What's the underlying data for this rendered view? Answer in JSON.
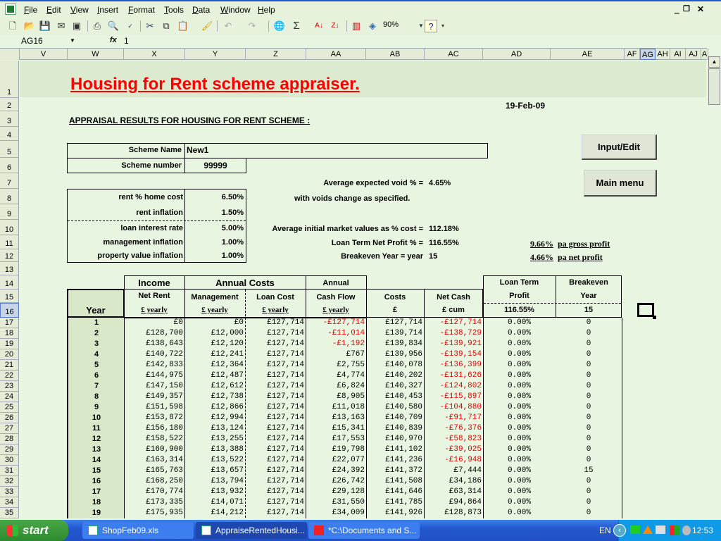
{
  "menubar": {
    "items": [
      "File",
      "Edit",
      "View",
      "Insert",
      "Format",
      "Tools",
      "Data",
      "Window",
      "Help"
    ],
    "window_controls": [
      "minimize",
      "restore",
      "close"
    ]
  },
  "toolbar": {
    "icons": [
      "new-icon",
      "open-icon",
      "save-icon",
      "email-icon",
      "permission-icon",
      "print-icon",
      "print-preview-icon",
      "spelling-icon",
      "cut-icon",
      "copy-icon",
      "paste-icon",
      "format-painter-icon",
      "undo-icon",
      "redo-icon",
      "hyperlink-icon",
      "autosum-icon",
      "sort-asc-icon",
      "sort-desc-icon",
      "chart-wizard-icon",
      "drawing-icon",
      "help-icon"
    ],
    "zoom": "90%"
  },
  "formula_bar": {
    "name_box": "AG16",
    "fx_label": "fx",
    "value": "1"
  },
  "columns": [
    "V",
    "W",
    "X",
    "Y",
    "Z",
    "AA",
    "AB",
    "AC",
    "AD",
    "AE",
    "AF",
    "AG",
    "AH",
    "AI",
    "AJ",
    "A"
  ],
  "selected_column": "AG",
  "rows": [
    "1",
    "2",
    "3",
    "4",
    "5",
    "6",
    "7",
    "8",
    "9",
    "10",
    "11",
    "12",
    "13",
    "14",
    "15",
    "16",
    "17",
    "18",
    "19",
    "20",
    "21",
    "22",
    "23",
    "24",
    "25",
    "26",
    "27",
    "28",
    "29",
    "30",
    "31",
    "32",
    "33",
    "34",
    "35"
  ],
  "selected_row": "16",
  "sheet": {
    "title": "Housing for Rent scheme appraiser.",
    "subtitle": "APPRAISAL RESULTS FOR HOUSING FOR RENT SCHEME :",
    "date": "19-Feb-09",
    "scheme_name_label": "Scheme Name",
    "scheme_name": "New1",
    "scheme_number_label": "Scheme number",
    "scheme_number": "99999",
    "params": [
      {
        "label": "rent % home cost",
        "value": "6.50%"
      },
      {
        "label": "rent inflation",
        "value": "1.50%"
      },
      {
        "label": "loan interest rate",
        "value": "5.00%"
      },
      {
        "label": "management inflation",
        "value": "1.00%"
      },
      {
        "label": "property value inflation",
        "value": "1.00%"
      }
    ],
    "void_label": "Average expected void % =",
    "void_value": "4.65%",
    "void_note": "with voids change as specified.",
    "market_label": "Average initial market values as % cost =",
    "market_value": "112.18%",
    "profit_label": "Loan Term Net Profit % =",
    "profit_value": "116.55%",
    "breakeven_label": "Breakeven Year = year",
    "breakeven_value": "15",
    "gross_pct": "9.66%",
    "gross_label": "pa gross profit",
    "net_pct": "4.66%",
    "net_label": "pa net profit",
    "buttons": {
      "input_edit": "Input/Edit",
      "main_menu": "Main menu"
    }
  },
  "table": {
    "group_headers": {
      "income": "Income",
      "annual_costs": "Annual Costs",
      "annual": "Annual",
      "loan_term": "Loan Term",
      "breakeven": "Breakeven"
    },
    "headers": {
      "year": "Year",
      "net_rent": "Net Rent",
      "net_rent_unit": "£ yearly",
      "management": "Management",
      "management_unit": "£ yearly",
      "loan_cost": "Loan Cost",
      "loan_cost_unit": "£ yearly",
      "cash_flow": "Cash Flow",
      "cash_flow_unit": "£ yearly",
      "costs": "Costs",
      "costs_unit": "£",
      "net_cash": "Net Cash",
      "net_cash_unit": "£ cum",
      "profit": "Profit",
      "profit_value": "116.55%",
      "year2": "Year",
      "year2_value": "15"
    },
    "rows": [
      {
        "year": "1",
        "net_rent": "£0",
        "mgmt": "£0",
        "loan": "£127,714",
        "cash": "-£127,714",
        "costs": "£127,714",
        "net": "-£127,714",
        "profit": "0.00%",
        "be": "0"
      },
      {
        "year": "2",
        "net_rent": "£128,700",
        "mgmt": "£12,000",
        "loan": "£127,714",
        "cash": "-£11,014",
        "costs": "£139,714",
        "net": "-£138,729",
        "profit": "0.00%",
        "be": "0"
      },
      {
        "year": "3",
        "net_rent": "£138,643",
        "mgmt": "£12,120",
        "loan": "£127,714",
        "cash": "-£1,192",
        "costs": "£139,834",
        "net": "-£139,921",
        "profit": "0.00%",
        "be": "0"
      },
      {
        "year": "4",
        "net_rent": "£140,722",
        "mgmt": "£12,241",
        "loan": "£127,714",
        "cash": "£767",
        "costs": "£139,956",
        "net": "-£139,154",
        "profit": "0.00%",
        "be": "0"
      },
      {
        "year": "5",
        "net_rent": "£142,833",
        "mgmt": "£12,364",
        "loan": "£127,714",
        "cash": "£2,755",
        "costs": "£140,078",
        "net": "-£136,399",
        "profit": "0.00%",
        "be": "0"
      },
      {
        "year": "6",
        "net_rent": "£144,975",
        "mgmt": "£12,487",
        "loan": "£127,714",
        "cash": "£4,774",
        "costs": "£140,202",
        "net": "-£131,626",
        "profit": "0.00%",
        "be": "0"
      },
      {
        "year": "7",
        "net_rent": "£147,150",
        "mgmt": "£12,612",
        "loan": "£127,714",
        "cash": "£6,824",
        "costs": "£140,327",
        "net": "-£124,802",
        "profit": "0.00%",
        "be": "0"
      },
      {
        "year": "8",
        "net_rent": "£149,357",
        "mgmt": "£12,738",
        "loan": "£127,714",
        "cash": "£8,905",
        "costs": "£140,453",
        "net": "-£115,897",
        "profit": "0.00%",
        "be": "0"
      },
      {
        "year": "9",
        "net_rent": "£151,598",
        "mgmt": "£12,866",
        "loan": "£127,714",
        "cash": "£11,018",
        "costs": "£140,580",
        "net": "-£104,880",
        "profit": "0.00%",
        "be": "0"
      },
      {
        "year": "10",
        "net_rent": "£153,872",
        "mgmt": "£12,994",
        "loan": "£127,714",
        "cash": "£13,163",
        "costs": "£140,709",
        "net": "-£91,717",
        "profit": "0.00%",
        "be": "0"
      },
      {
        "year": "11",
        "net_rent": "£156,180",
        "mgmt": "£13,124",
        "loan": "£127,714",
        "cash": "£15,341",
        "costs": "£140,839",
        "net": "-£76,376",
        "profit": "0.00%",
        "be": "0"
      },
      {
        "year": "12",
        "net_rent": "£158,522",
        "mgmt": "£13,255",
        "loan": "£127,714",
        "cash": "£17,553",
        "costs": "£140,970",
        "net": "-£58,823",
        "profit": "0.00%",
        "be": "0"
      },
      {
        "year": "13",
        "net_rent": "£160,900",
        "mgmt": "£13,388",
        "loan": "£127,714",
        "cash": "£19,798",
        "costs": "£141,102",
        "net": "-£39,025",
        "profit": "0.00%",
        "be": "0"
      },
      {
        "year": "14",
        "net_rent": "£163,314",
        "mgmt": "£13,522",
        "loan": "£127,714",
        "cash": "£22,077",
        "costs": "£141,236",
        "net": "-£16,948",
        "profit": "0.00%",
        "be": "0"
      },
      {
        "year": "15",
        "net_rent": "£165,763",
        "mgmt": "£13,657",
        "loan": "£127,714",
        "cash": "£24,392",
        "costs": "£141,372",
        "net": "£7,444",
        "profit": "0.00%",
        "be": "15"
      },
      {
        "year": "16",
        "net_rent": "£168,250",
        "mgmt": "£13,794",
        "loan": "£127,714",
        "cash": "£26,742",
        "costs": "£141,508",
        "net": "£34,186",
        "profit": "0.00%",
        "be": "0"
      },
      {
        "year": "17",
        "net_rent": "£170,774",
        "mgmt": "£13,932",
        "loan": "£127,714",
        "cash": "£29,128",
        "costs": "£141,646",
        "net": "£63,314",
        "profit": "0.00%",
        "be": "0"
      },
      {
        "year": "18",
        "net_rent": "£173,335",
        "mgmt": "£14,071",
        "loan": "£127,714",
        "cash": "£31,550",
        "costs": "£141,785",
        "net": "£94,864",
        "profit": "0.00%",
        "be": "0"
      },
      {
        "year": "19",
        "net_rent": "£175,935",
        "mgmt": "£14,212",
        "loan": "£127,714",
        "cash": "£34,009",
        "costs": "£141,926",
        "net": "£128,873",
        "profit": "0.00%",
        "be": "0"
      }
    ]
  },
  "taskbar": {
    "start": "start",
    "tasks": [
      "ShopFeb09.xls",
      "AppraiseRentedHousi...",
      "*C:\\Documents and S..."
    ],
    "active_task": 1,
    "language": "EN",
    "clock": "12:53"
  },
  "colors": {
    "negative": "#e00000",
    "title": "#ff0000",
    "sheet_bg": "#e8f5e0"
  }
}
